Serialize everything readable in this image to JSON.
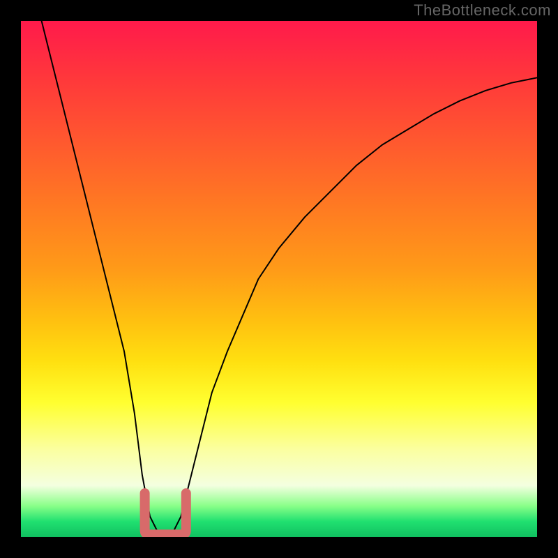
{
  "watermark": "TheBottleneck.com",
  "chart_data": {
    "type": "line",
    "title": "",
    "xlabel": "",
    "ylabel": "",
    "xlim": [
      0,
      100
    ],
    "ylim": [
      0,
      100
    ],
    "series": [
      {
        "name": "bottleneck-curve",
        "x": [
          4,
          6,
          8,
          10,
          12,
          14,
          16,
          18,
          20,
          22,
          23.5,
          25,
          26.5,
          28,
          29.5,
          31,
          33,
          35,
          37,
          40,
          43,
          46,
          50,
          55,
          60,
          65,
          70,
          75,
          80,
          85,
          90,
          95,
          100
        ],
        "y": [
          100,
          92,
          84,
          76,
          68,
          60,
          52,
          44,
          36,
          24,
          12,
          4,
          1,
          0.5,
          1,
          4,
          12,
          20,
          28,
          36,
          43,
          50,
          56,
          62,
          67,
          72,
          76,
          79,
          82,
          84.5,
          86.5,
          88,
          89
        ]
      }
    ],
    "highlight_region": {
      "name": "minimum-marker",
      "x_range": [
        24,
        32
      ],
      "y_level": 0.5,
      "color": "#d86a6a"
    },
    "gradient_stops": [
      {
        "pos": 0,
        "color": "#ff1a4b"
      },
      {
        "pos": 50,
        "color": "#ff9a18"
      },
      {
        "pos": 75,
        "color": "#ffff30"
      },
      {
        "pos": 100,
        "color": "#10c060"
      }
    ]
  }
}
